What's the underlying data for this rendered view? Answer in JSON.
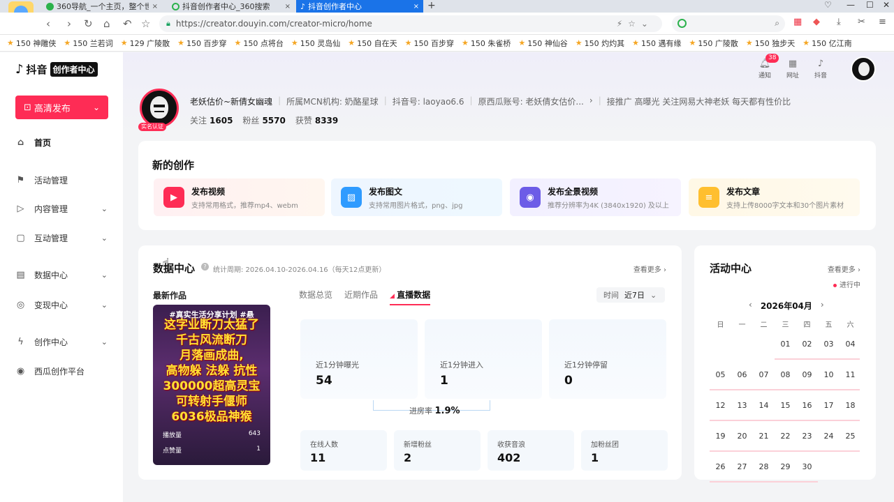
{
  "browser": {
    "tabs": [
      {
        "label": "360导航_一个主页，整个世界",
        "close": "×"
      },
      {
        "label": "抖音创作者中心_360搜索",
        "close": "×"
      },
      {
        "label": "抖音创作者中心",
        "close": "×"
      }
    ],
    "new_tab": "+",
    "url": "https://creator.douyin.com/creator-micro/home",
    "bookmarks": [
      "150 神雕侠",
      "150 兰若词",
      "129 广陵散",
      "150 百步穿",
      "150 点将台",
      "150 灵岛仙",
      "150 自在天",
      "150 百步穿",
      "150 朱雀桥",
      "150 神仙谷",
      "150 灼灼其",
      "150 遇有缘",
      "150 广陵散",
      "150 独步天",
      "150 亿江南"
    ],
    "accent": "#1a73e8"
  },
  "sidebar": {
    "logo_brand": "抖音",
    "logo_tag": "创作者中心",
    "publish_button": "高清发布",
    "items": [
      {
        "label": "首页",
        "icon": "home-icon"
      },
      {
        "label": "活动管理",
        "icon": "flag-icon"
      },
      {
        "label": "内容管理",
        "icon": "play-square-icon"
      },
      {
        "label": "互动管理",
        "icon": "chat-icon"
      },
      {
        "label": "数据中心",
        "icon": "chart-icon"
      },
      {
        "label": "变现中心",
        "icon": "coin-icon"
      },
      {
        "label": "创作中心",
        "icon": "bolt-icon"
      },
      {
        "label": "西瓜创作平台",
        "icon": "watermelon-icon"
      }
    ]
  },
  "profile": {
    "badge": "实名认证",
    "name": "老妖估价~新倩女幽魂",
    "mcn": "所属MCN机构: 奶酪星球",
    "douyin_id": "抖音号: laoyao6.6",
    "xigua": "原西瓜账号: 老妖倩女估价...",
    "bio": "接推广 高曝光 关注网易大神老妖 每天都有性价比",
    "follow_label": "关注",
    "follow": "1605",
    "fans_label": "粉丝",
    "fans": "5570",
    "likes_label": "获赞",
    "likes": "8339"
  },
  "topbar": {
    "notif_label": "通知",
    "notif_count": "38",
    "web_label": "网址",
    "douyin_label": "抖音"
  },
  "new_creation": {
    "title": "新的创作",
    "tiles": [
      {
        "title": "发布视频",
        "sub": "支持常用格式，推荐mp4、webm",
        "color": "#fe2c55"
      },
      {
        "title": "发布图文",
        "sub": "支持常用图片格式，png、jpg",
        "color": "#2f9bff"
      },
      {
        "title": "发布全景视频",
        "sub": "推荐分辨率为4K (3840x1920) 及以上",
        "color": "#6c5ce7"
      },
      {
        "title": "发布文章",
        "sub": "支持上传8000字文本和30个图片素材",
        "color": "#ffbf2f"
      }
    ]
  },
  "data_center": {
    "title": "数据中心",
    "period": "统计周期: 2026.04.10-2026.04.16（每天12点更新）",
    "more": "查看更多 ›",
    "latest_label": "最新作品",
    "cover_lines": [
      "#真实生活分享计划 #悬",
      "这字业断刀太猛了",
      "千古风流断刀",
      "月落画成曲,",
      "高物躲 法躲 抗性",
      "300000超高灵宝",
      "可转射手偃师",
      "6036极品神猴"
    ],
    "plays_label": "播放量",
    "plays": "643",
    "likes_label": "点赞量",
    "likes": "1",
    "tabs": [
      "数据总览",
      "近期作品",
      "直播数据"
    ],
    "time_label": "时间",
    "time_value": "近7日",
    "metrics": [
      {
        "label": "近1分钟曝光",
        "value": "54"
      },
      {
        "label": "近1分钟进入",
        "value": "1"
      },
      {
        "label": "近1分钟停留",
        "value": "0"
      }
    ],
    "conversion_label": "进房率",
    "conversion_value": "1.9%",
    "stats": [
      {
        "label": "在线人数",
        "value": "11"
      },
      {
        "label": "新增粉丝",
        "value": "2"
      },
      {
        "label": "收获音浪",
        "value": "402"
      },
      {
        "label": "加粉丝团",
        "value": "1"
      }
    ]
  },
  "activity": {
    "title": "活动中心",
    "more": "查看更多 ›",
    "ongoing": "进行中",
    "month": "2026年04月",
    "weekdays": [
      "日",
      "一",
      "二",
      "三",
      "四",
      "五",
      "六"
    ],
    "weeks": [
      [
        "",
        "",
        "",
        "01",
        "02",
        "03",
        "04"
      ],
      [
        "05",
        "06",
        "07",
        "08",
        "09",
        "10",
        "11"
      ],
      [
        "12",
        "13",
        "14",
        "15",
        "16",
        "17",
        "18"
      ],
      [
        "19",
        "20",
        "21",
        "22",
        "23",
        "24",
        "25"
      ],
      [
        "26",
        "27",
        "28",
        "29",
        "30",
        "",
        ""
      ]
    ],
    "highlight": "#fe2c55"
  }
}
